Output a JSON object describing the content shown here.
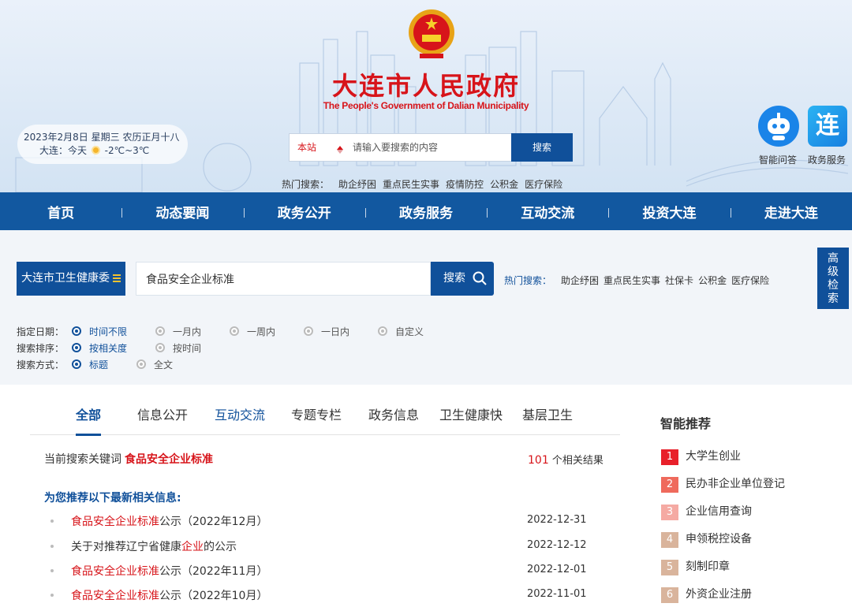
{
  "header": {
    "title": "大连市人民政府",
    "subtitle": "The People's Government of Dalian Municipality",
    "date_line": "2023年2月8日 星期三 农历正月十八",
    "weather_line": "大连：今天",
    "temperature": "-2℃~3℃",
    "search": {
      "scope": "本站",
      "placeholder": "请输入要搜索的内容",
      "button": "搜索"
    },
    "hot_label": "热门搜索：",
    "hot_terms": [
      "助企纾困",
      "重点民生实事",
      "疫情防控",
      "公积金",
      "医疗保险"
    ],
    "quick_icons": [
      {
        "label": "智能问答",
        "icon": "robot-icon"
      },
      {
        "label": "政务服务",
        "icon": "lian-logo-icon",
        "glyph": "连"
      }
    ]
  },
  "nav": [
    "首页",
    "动态要闻",
    "政务公开",
    "政务服务",
    "互动交流",
    "投资大连",
    "走进大连"
  ],
  "search_panel": {
    "department": "大连市卫生健康委",
    "query": "食品安全企业标准",
    "button": "搜索",
    "hot_label": "热门搜索：",
    "hot_terms": [
      "助企纾困",
      "重点民生实事",
      "社保卡",
      "公积金",
      "医疗保险"
    ],
    "advanced": [
      "高",
      "级",
      "检",
      "索"
    ]
  },
  "filters": {
    "date": {
      "label": "指定日期：",
      "options": [
        "时间不限",
        "一月内",
        "一周内",
        "一日内",
        "自定义"
      ],
      "selected": 0
    },
    "sort": {
      "label": "搜索排序：",
      "options": [
        "按相关度",
        "按时间"
      ],
      "selected": 0
    },
    "mode": {
      "label": "搜索方式：",
      "options": [
        "标题",
        "全文"
      ],
      "selected": 0
    }
  },
  "results": {
    "tabs": [
      "全部",
      "信息公开",
      "互动交流",
      "专题专栏",
      "政务信息",
      "卫生健康快",
      "基层卫生"
    ],
    "active_tab": 0,
    "keyword_prefix": "当前搜索关键词",
    "keyword": "食品安全企业标准",
    "count": "101",
    "count_suffix": " 个相关结果",
    "recommend_title": "为您推荐以下最新相关信息:",
    "items": [
      {
        "pre": "",
        "hl": "食品安全企业标准",
        "post": "公示（2022年12月）",
        "date": "2022-12-31"
      },
      {
        "pre": "关于对推荐辽宁省健康",
        "hl": "企业",
        "post": "的公示",
        "date": "2022-12-12"
      },
      {
        "pre": "",
        "hl": "食品安全企业标准",
        "post": "公示（2022年11月）",
        "date": "2022-12-01"
      },
      {
        "pre": "",
        "hl": "食品安全企业标准",
        "post": "公示（2022年10月）",
        "date": "2022-11-01"
      }
    ]
  },
  "sidebar": {
    "title": "智能推荐",
    "items": [
      {
        "rank": "1",
        "label": "大学生创业",
        "color": "#e8202a"
      },
      {
        "rank": "2",
        "label": "民办非企业单位登记",
        "color": "#ef6a5c"
      },
      {
        "rank": "3",
        "label": "企业信用查询",
        "color": "#f5aaa3"
      },
      {
        "rank": "4",
        "label": "申领税控设备",
        "color": "#d9b49c"
      },
      {
        "rank": "5",
        "label": "刻制印章",
        "color": "#d9b49c"
      },
      {
        "rank": "6",
        "label": "外资企业注册",
        "color": "#d9b49c"
      }
    ]
  },
  "colors": {
    "brand_blue": "#10509a",
    "nav_blue": "#1258a0",
    "accent_red": "#d7141a"
  }
}
